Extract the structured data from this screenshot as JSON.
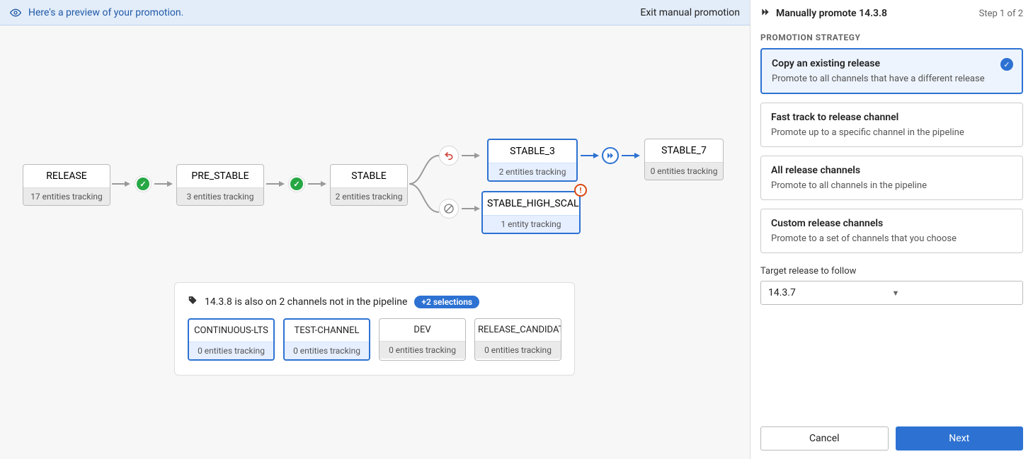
{
  "banner": {
    "text": "Here's a preview of your promotion.",
    "exit": "Exit manual promotion"
  },
  "nodes": {
    "release": {
      "name": "RELEASE",
      "sub": "17 entities tracking"
    },
    "prestable": {
      "name": "PRE_STABLE",
      "sub": "3 entities tracking"
    },
    "stable": {
      "name": "STABLE",
      "sub": "2 entities tracking"
    },
    "stable3": {
      "name": "STABLE_3",
      "sub": "2 entities tracking"
    },
    "stable7": {
      "name": "STABLE_7",
      "sub": "0 entities tracking"
    },
    "stablehs": {
      "name": "STABLE_HIGH_SCALE",
      "sub": "1 entity tracking"
    }
  },
  "extra": {
    "header": "14.3.8 is also on 2 channels not in the pipeline",
    "pill": "+2 selections",
    "chips": [
      {
        "name": "CONTINUOUS-LTS",
        "sub": "0 entities tracking",
        "selected": true
      },
      {
        "name": "TEST-CHANNEL",
        "sub": "0 entities tracking",
        "selected": true
      },
      {
        "name": "DEV",
        "sub": "0 entities tracking",
        "selected": false
      },
      {
        "name": "RELEASE_CANDIDATE",
        "sub": "0 entities tracking",
        "selected": false
      }
    ]
  },
  "sidebar": {
    "title": "Manually promote 14.3.8",
    "step": "Step 1 of 2",
    "section": "PROMOTION STRATEGY",
    "options": [
      {
        "title": "Copy an existing release",
        "desc": "Promote to all channels that have a different release",
        "selected": true
      },
      {
        "title": "Fast track to release channel",
        "desc": "Promote up to a specific channel in the pipeline",
        "selected": false
      },
      {
        "title": "All release channels",
        "desc": "Promote to all channels in the pipeline",
        "selected": false
      },
      {
        "title": "Custom release channels",
        "desc": "Promote to a set of channels that you choose",
        "selected": false
      }
    ],
    "target_label": "Target release to follow",
    "target_value": "14.3.7",
    "cancel": "Cancel",
    "next": "Next"
  }
}
